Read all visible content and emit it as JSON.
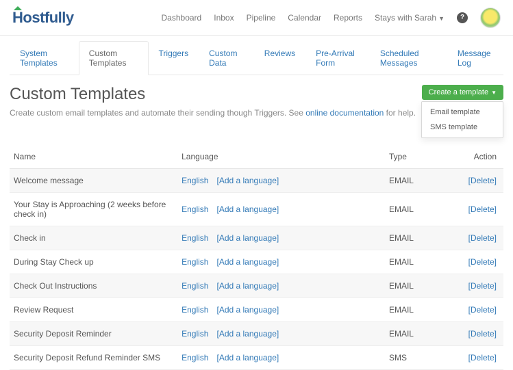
{
  "brand": {
    "text": "Hostfully"
  },
  "topnav": {
    "items": [
      "Dashboard",
      "Inbox",
      "Pipeline",
      "Calendar",
      "Reports"
    ],
    "user_menu": "Stays with Sarah"
  },
  "subnav": {
    "items": [
      {
        "label": "System Templates",
        "active": false
      },
      {
        "label": "Custom Templates",
        "active": true
      },
      {
        "label": "Triggers",
        "active": false
      },
      {
        "label": "Custom Data",
        "active": false
      },
      {
        "label": "Reviews",
        "active": false
      },
      {
        "label": "Pre-Arrival Form",
        "active": false
      },
      {
        "label": "Scheduled Messages",
        "active": false
      },
      {
        "label": "Message Log",
        "active": false
      }
    ]
  },
  "page": {
    "title": "Custom Templates",
    "subtitle_pre": "Create custom email templates and automate their sending though Triggers. See ",
    "subtitle_link": "online documentation",
    "subtitle_post": " for help."
  },
  "create": {
    "button": "Create a template",
    "menu": [
      "Email template",
      "SMS template"
    ]
  },
  "table": {
    "headers": {
      "name": "Name",
      "language": "Language",
      "type": "Type",
      "action": "Action"
    },
    "lang_link": "English",
    "add_lang": "[Add a language]",
    "delete": "[Delete]",
    "rows": [
      {
        "name": "Welcome message",
        "type": "EMAIL"
      },
      {
        "name": "Your Stay is Approaching (2 weeks before check in)",
        "type": "EMAIL"
      },
      {
        "name": "Check in",
        "type": "EMAIL"
      },
      {
        "name": "During Stay Check up",
        "type": "EMAIL"
      },
      {
        "name": "Check Out Instructions",
        "type": "EMAIL"
      },
      {
        "name": "Review Request",
        "type": "EMAIL"
      },
      {
        "name": "Security Deposit Reminder",
        "type": "EMAIL"
      },
      {
        "name": "Security Deposit Refund Reminder SMS",
        "type": "SMS"
      }
    ]
  }
}
